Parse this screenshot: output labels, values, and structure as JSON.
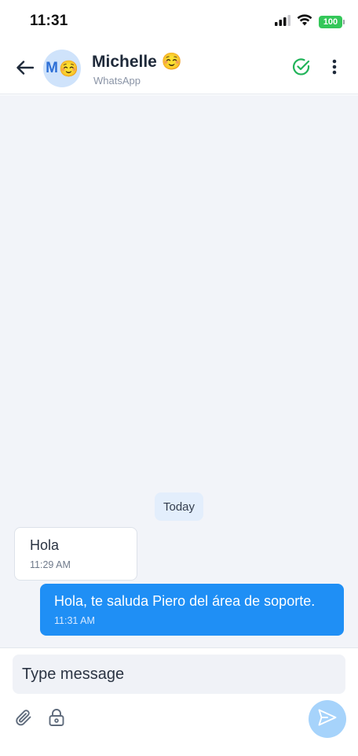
{
  "status_bar": {
    "time": "11:31",
    "battery": "100",
    "battery_color": "#34c759"
  },
  "header": {
    "avatar_initial": "M",
    "avatar_emoji": "☺️",
    "contact_name": "Michelle ☺️",
    "channel": "WhatsApp",
    "back_icon": "arrow-left-icon",
    "resolve_icon": "check-circle-icon",
    "more_icon": "more-vertical-icon",
    "resolve_color": "#22b45a"
  },
  "chat": {
    "date_divider": "Today",
    "messages": [
      {
        "direction": "incoming",
        "text": "Hola",
        "time": "11:29 AM"
      },
      {
        "direction": "outgoing",
        "text": "Hola, te saluda Piero del área de soporte.",
        "time": "11:31 AM"
      }
    ],
    "outgoing_color": "#1f8ff5"
  },
  "composer": {
    "placeholder": "Type message",
    "attach_icon": "paperclip-icon",
    "private_icon": "lock-icon",
    "send_icon": "send-icon",
    "send_color": "#a6d3fb"
  }
}
